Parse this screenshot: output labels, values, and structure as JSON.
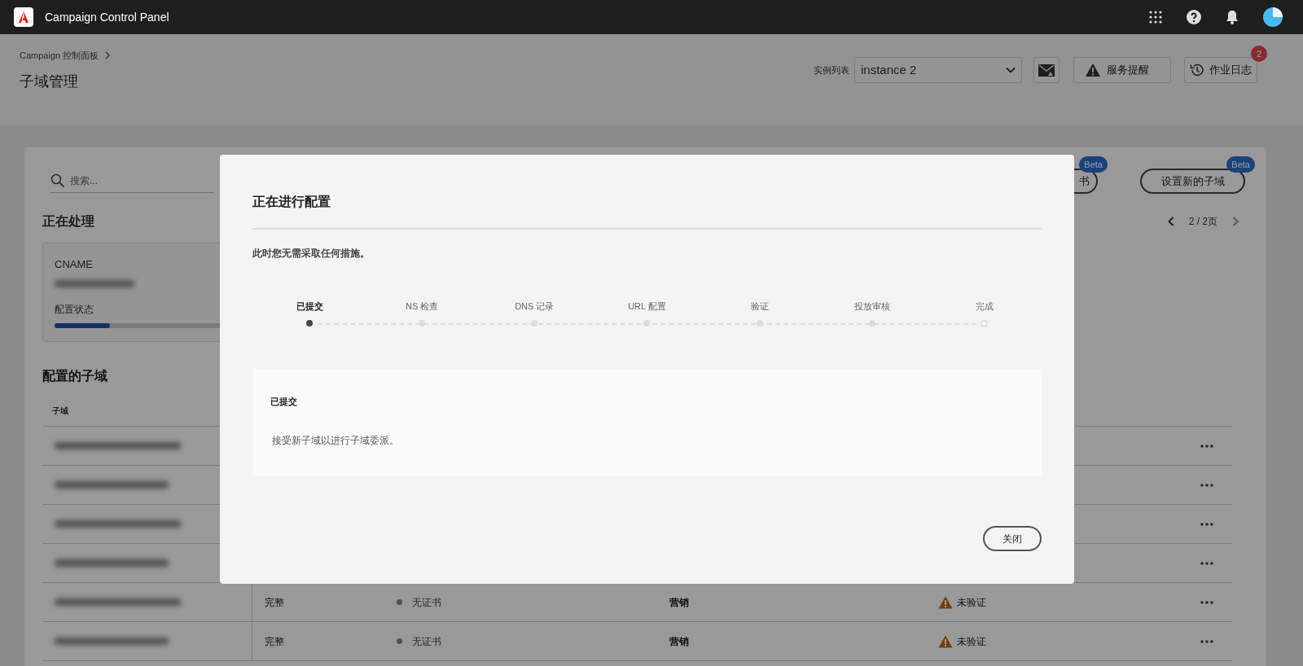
{
  "app": {
    "title": "Campaign Control Panel"
  },
  "header": {
    "breadcrumb": "Campaign 控制面板",
    "title": "子域管理",
    "instance_label": "实例列表",
    "instance_value": "instance 2",
    "alerts_button": "服务提醒",
    "jobs_button": "作业日志",
    "jobs_badge": "2"
  },
  "toolbar": {
    "search_placeholder": "搜索...",
    "buttons": [
      {
        "label": "书",
        "badge": "Beta"
      },
      {
        "label": "设置新的子域",
        "badge": "Beta"
      }
    ],
    "pagination": "2 / 2页"
  },
  "processing": {
    "heading": "正在处理",
    "card": {
      "cname_label": "CNAME",
      "status_label": "配置状态",
      "level": 0.25
    }
  },
  "table": {
    "heading": "配置的子域",
    "columns": [
      "子域"
    ],
    "rows": [
      {},
      {},
      {},
      {},
      {
        "status": "完整",
        "certificate": "无证书",
        "type": "营销",
        "verification": "未验证"
      },
      {
        "status": "完整",
        "certificate": "无证书",
        "type": "营销",
        "verification": "未验证"
      }
    ]
  },
  "dialog": {
    "title": "正在进行配置",
    "message": "此时您无需采取任何措施。",
    "steps": [
      {
        "label": "已提交",
        "selected": true
      },
      {
        "label": "NS 检查",
        "selected": false
      },
      {
        "label": "DNS 记录",
        "selected": false
      },
      {
        "label": "URL 配置",
        "selected": false
      },
      {
        "label": "验证",
        "selected": false
      },
      {
        "label": "投放审核",
        "selected": false
      },
      {
        "label": "完成",
        "selected": false,
        "kind": "end"
      }
    ],
    "detail_title": "已提交",
    "detail_text": "接受新子域以进行子域委派。",
    "close_button": "关闭"
  }
}
